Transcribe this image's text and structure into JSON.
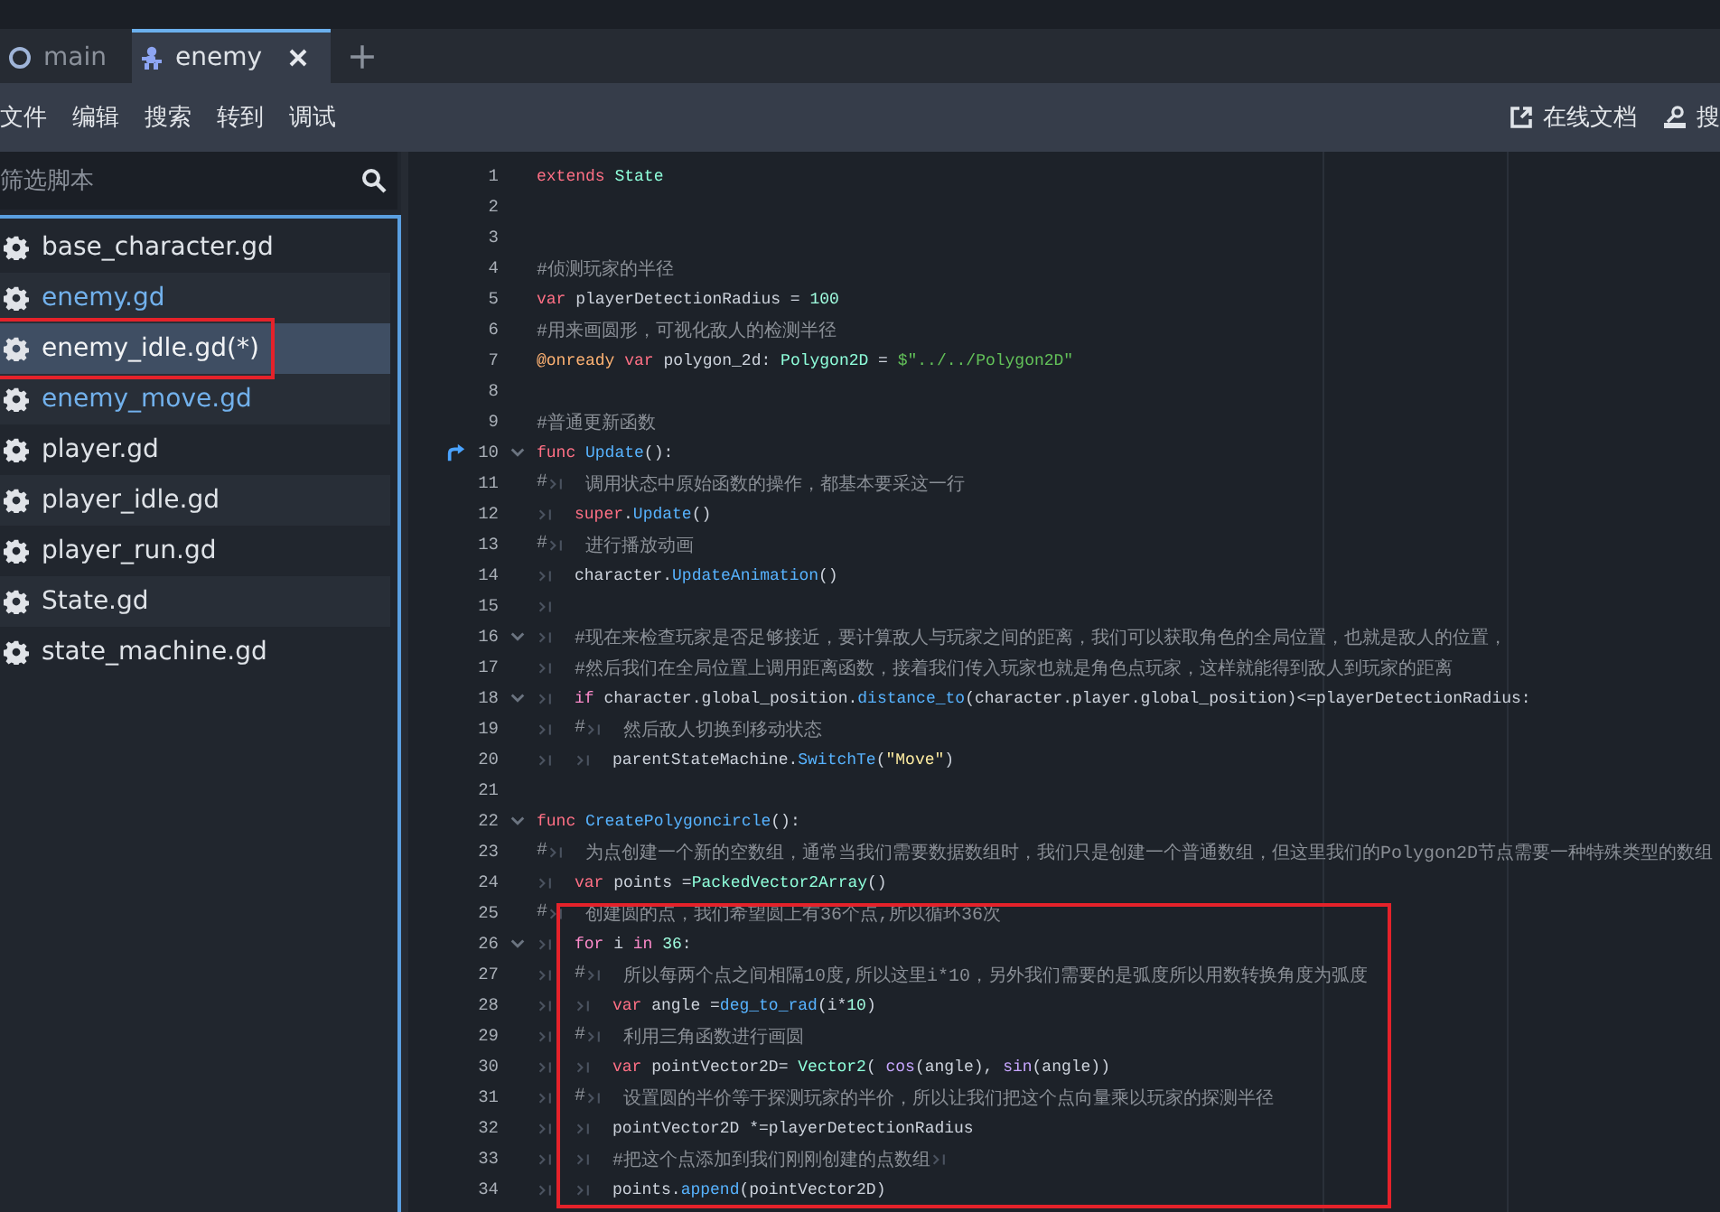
{
  "tabs": [
    {
      "label": "main",
      "kind": "scene",
      "selected": false
    },
    {
      "label": "enemy",
      "kind": "character",
      "selected": true
    }
  ],
  "menu": [
    "文件",
    "编辑",
    "搜索",
    "转到",
    "调试"
  ],
  "help_links": [
    {
      "label": "在线文档",
      "kind": "external"
    },
    {
      "label": "搜",
      "kind": "doc"
    }
  ],
  "filter": {
    "placeholder": "筛选脚本"
  },
  "scripts": [
    {
      "name": "base_character.gd",
      "selected": false,
      "open": false,
      "circled": false
    },
    {
      "name": "enemy.gd",
      "selected": false,
      "open": true,
      "circled": false
    },
    {
      "name": "enemy_idle.gd(*)",
      "selected": true,
      "open": false,
      "circled": true
    },
    {
      "name": "enemy_move.gd",
      "selected": false,
      "open": true,
      "circled": false
    },
    {
      "name": "player.gd",
      "selected": false,
      "open": false,
      "circled": false
    },
    {
      "name": "player_idle.gd",
      "selected": false,
      "open": false,
      "circled": false
    },
    {
      "name": "player_run.gd",
      "selected": false,
      "open": false,
      "circled": false
    },
    {
      "name": "State.gd",
      "selected": false,
      "open": false,
      "circled": false
    },
    {
      "name": "state_machine.gd",
      "selected": false,
      "open": false,
      "circled": false
    }
  ],
  "code": [
    {
      "n": "1",
      "fold": false,
      "override": false,
      "boxed": false,
      "tokens": [
        {
          "kind": "kw",
          "text": "extends"
        },
        {
          "kind": "cls",
          "text": " State"
        }
      ]
    },
    {
      "n": "2",
      "fold": false,
      "override": false,
      "boxed": false
    },
    {
      "n": "3",
      "fold": false,
      "override": false,
      "boxed": false
    },
    {
      "n": "4",
      "fold": false,
      "override": false,
      "boxed": false,
      "tokens": [
        {
          "kind": "cmt",
          "text": "#侦测玩家的半径"
        }
      ]
    },
    {
      "n": "5",
      "fold": false,
      "override": false,
      "boxed": false,
      "tokens": [
        {
          "kind": "kw",
          "text": "var"
        },
        {
          "kind": "plain",
          "text": " playerDetectionRadius = "
        },
        {
          "kind": "num",
          "text": "100"
        }
      ]
    },
    {
      "n": "6",
      "fold": false,
      "override": false,
      "boxed": false,
      "tokens": [
        {
          "kind": "cmt",
          "text": "#用来画圆形，可视化敌人的检测半径"
        }
      ]
    },
    {
      "n": "7",
      "fold": false,
      "override": false,
      "boxed": false,
      "tokens": [
        {
          "kind": "annot",
          "text": "@onready"
        },
        {
          "kind": "kw",
          "text": " var"
        },
        {
          "kind": "plain",
          "text": " polygon_2d: "
        },
        {
          "kind": "cls",
          "text": "Polygon2D"
        },
        {
          "kind": "plain",
          "text": " = "
        },
        {
          "kind": "path",
          "text": "$\"../../Polygon2D\""
        }
      ]
    },
    {
      "n": "8",
      "fold": false,
      "override": false,
      "boxed": false
    },
    {
      "n": "9",
      "fold": false,
      "override": false,
      "boxed": false,
      "tokens": [
        {
          "kind": "cmt",
          "text": "#普通更新函数"
        }
      ]
    },
    {
      "n": "10",
      "fold": true,
      "override": true,
      "boxed": false,
      "tokens": [
        {
          "kind": "kw",
          "text": "func"
        },
        {
          "kind": "fn",
          "text": " Update"
        },
        {
          "kind": "plain",
          "text": "():"
        }
      ]
    },
    {
      "n": "11",
      "fold": false,
      "override": false,
      "boxed": false,
      "tokens": [
        {
          "kind": "cmt",
          "text": "#"
        },
        {
          "kind": "tab"
        },
        {
          "kind": "cmt",
          "text": "调用状态中原始函数的操作，都基本要采这一行"
        }
      ]
    },
    {
      "n": "12",
      "fold": false,
      "override": false,
      "boxed": false,
      "tokens": [
        {
          "kind": "tab"
        },
        {
          "kind": "kw",
          "text": "super"
        },
        {
          "kind": "plain",
          "text": "."
        },
        {
          "kind": "fn",
          "text": "Update"
        },
        {
          "kind": "plain",
          "text": "()"
        }
      ]
    },
    {
      "n": "13",
      "fold": false,
      "override": false,
      "boxed": false,
      "tokens": [
        {
          "kind": "cmt",
          "text": "#"
        },
        {
          "kind": "tab"
        },
        {
          "kind": "cmt",
          "text": "进行播放动画"
        }
      ]
    },
    {
      "n": "14",
      "fold": false,
      "override": false,
      "boxed": false,
      "tokens": [
        {
          "kind": "tab"
        },
        {
          "kind": "plain",
          "text": "character."
        },
        {
          "kind": "fn",
          "text": "UpdateAnimation"
        },
        {
          "kind": "plain",
          "text": "()"
        }
      ]
    },
    {
      "n": "15",
      "fold": false,
      "override": false,
      "boxed": false,
      "tokens": [
        {
          "kind": "tab"
        }
      ]
    },
    {
      "n": "16",
      "fold": true,
      "override": false,
      "boxed": false,
      "tokens": [
        {
          "kind": "tab"
        },
        {
          "kind": "cmt",
          "text": "#现在来检查玩家是否足够接近，要计算敌人与玩家之间的距离，我们可以获取角色的全局位置，也就是敌人的位置，"
        }
      ]
    },
    {
      "n": "17",
      "fold": false,
      "override": false,
      "boxed": false,
      "tokens": [
        {
          "kind": "tab"
        },
        {
          "kind": "cmt",
          "text": "#然后我们在全局位置上调用距离函数，接着我们传入玩家也就是角色点玩家，这样就能得到敌人到玩家的距离"
        }
      ]
    },
    {
      "n": "18",
      "fold": true,
      "override": false,
      "boxed": false,
      "tokens": [
        {
          "kind": "tab"
        },
        {
          "kind": "flow",
          "text": "if"
        },
        {
          "kind": "plain",
          "text": " character.global_position."
        },
        {
          "kind": "fn",
          "text": "distance_to"
        },
        {
          "kind": "plain",
          "text": "(character.player.global_position)<=playerDetectionRadius:"
        }
      ]
    },
    {
      "n": "19",
      "fold": false,
      "override": false,
      "boxed": false,
      "tokens": [
        {
          "kind": "tab"
        },
        {
          "kind": "cmt",
          "text": "#"
        },
        {
          "kind": "tab"
        },
        {
          "kind": "cmt",
          "text": "然后敌人切换到移动状态"
        }
      ]
    },
    {
      "n": "20",
      "fold": false,
      "override": false,
      "boxed": false,
      "tokens": [
        {
          "kind": "tab"
        },
        {
          "kind": "tab"
        },
        {
          "kind": "plain",
          "text": "parentStateMachine."
        },
        {
          "kind": "fn",
          "text": "SwitchTe"
        },
        {
          "kind": "plain",
          "text": "("
        },
        {
          "kind": "str",
          "text": "\"Move\""
        },
        {
          "kind": "plain",
          "text": ")"
        }
      ]
    },
    {
      "n": "21",
      "fold": false,
      "override": false,
      "boxed": false
    },
    {
      "n": "22",
      "fold": true,
      "override": false,
      "boxed": false,
      "tokens": [
        {
          "kind": "kw",
          "text": "func"
        },
        {
          "kind": "fn",
          "text": " CreatePolygoncircle"
        },
        {
          "kind": "plain",
          "text": "():"
        }
      ]
    },
    {
      "n": "23",
      "fold": false,
      "override": false,
      "boxed": false,
      "tokens": [
        {
          "kind": "cmt",
          "text": "#"
        },
        {
          "kind": "tab"
        },
        {
          "kind": "cmt",
          "text": "为点创建一个新的空数组，通常当我们需要数据数组时，我们只是创建一个普通数组，但这里我们的Polygon2D节点需要一种特殊类型的数组"
        }
      ]
    },
    {
      "n": "24",
      "fold": false,
      "override": false,
      "boxed": false,
      "tokens": [
        {
          "kind": "tab"
        },
        {
          "kind": "kw",
          "text": "var"
        },
        {
          "kind": "plain",
          "text": " points ="
        },
        {
          "kind": "cls",
          "text": "PackedVector2Array"
        },
        {
          "kind": "plain",
          "text": "()"
        }
      ]
    },
    {
      "n": "25",
      "fold": false,
      "override": false,
      "boxed": true,
      "tokens": [
        {
          "kind": "cmt",
          "text": "#"
        },
        {
          "kind": "tab"
        },
        {
          "kind": "cmt",
          "text": "创建圆的点，我们希望圆上有36个点,所以循环36次"
        }
      ]
    },
    {
      "n": "26",
      "fold": true,
      "override": false,
      "boxed": true,
      "tokens": [
        {
          "kind": "tab"
        },
        {
          "kind": "flow",
          "text": "for"
        },
        {
          "kind": "plain",
          "text": " i "
        },
        {
          "kind": "flow",
          "text": "in"
        },
        {
          "kind": "num",
          "text": " 36"
        },
        {
          "kind": "plain",
          "text": ":"
        }
      ]
    },
    {
      "n": "27",
      "fold": false,
      "override": false,
      "boxed": true,
      "tokens": [
        {
          "kind": "tab"
        },
        {
          "kind": "cmt",
          "text": "#"
        },
        {
          "kind": "tab"
        },
        {
          "kind": "cmt",
          "text": "所以每两个点之间相隔10度,所以这里i*10，另外我们需要的是弧度所以用数转换角度为弧度"
        }
      ]
    },
    {
      "n": "28",
      "fold": false,
      "override": false,
      "boxed": true,
      "tokens": [
        {
          "kind": "tab"
        },
        {
          "kind": "tab"
        },
        {
          "kind": "kw",
          "text": "var"
        },
        {
          "kind": "plain",
          "text": " angle ="
        },
        {
          "kind": "fn",
          "text": "deg_to_rad"
        },
        {
          "kind": "plain",
          "text": "(i*"
        },
        {
          "kind": "num",
          "text": "10"
        },
        {
          "kind": "plain",
          "text": ")"
        }
      ]
    },
    {
      "n": "29",
      "fold": false,
      "override": false,
      "boxed": true,
      "tokens": [
        {
          "kind": "tab"
        },
        {
          "kind": "cmt",
          "text": "#"
        },
        {
          "kind": "tab"
        },
        {
          "kind": "cmt",
          "text": "利用三角函数进行画圆"
        }
      ]
    },
    {
      "n": "30",
      "fold": false,
      "override": false,
      "boxed": true,
      "tokens": [
        {
          "kind": "tab"
        },
        {
          "kind": "tab"
        },
        {
          "kind": "kw",
          "text": "var"
        },
        {
          "kind": "plain",
          "text": " pointVector2D= "
        },
        {
          "kind": "cls",
          "text": "Vector2"
        },
        {
          "kind": "plain",
          "text": "( "
        },
        {
          "kind": "fn2",
          "text": "cos"
        },
        {
          "kind": "plain",
          "text": "(angle), "
        },
        {
          "kind": "fn2",
          "text": "sin"
        },
        {
          "kind": "plain",
          "text": "(angle))"
        }
      ]
    },
    {
      "n": "31",
      "fold": false,
      "override": false,
      "boxed": true,
      "tokens": [
        {
          "kind": "tab"
        },
        {
          "kind": "cmt",
          "text": "#"
        },
        {
          "kind": "tab"
        },
        {
          "kind": "cmt",
          "text": "设置圆的半价等于探测玩家的半价，所以让我们把这个点向量乘以玩家的探测半径"
        }
      ]
    },
    {
      "n": "32",
      "fold": false,
      "override": false,
      "boxed": true,
      "tokens": [
        {
          "kind": "tab"
        },
        {
          "kind": "tab"
        },
        {
          "kind": "plain",
          "text": "pointVector2D *=playerDetectionRadius"
        }
      ]
    },
    {
      "n": "33",
      "fold": false,
      "override": false,
      "boxed": true,
      "tokens": [
        {
          "kind": "tab"
        },
        {
          "kind": "tab"
        },
        {
          "kind": "cmt",
          "text": "#把这个点添加到我们刚刚创建的点数组"
        },
        {
          "kind": "tab"
        }
      ]
    },
    {
      "n": "34",
      "fold": false,
      "override": false,
      "boxed": true,
      "tokens": [
        {
          "kind": "tab"
        },
        {
          "kind": "tab"
        },
        {
          "kind": "plain",
          "text": "points."
        },
        {
          "kind": "fn",
          "text": "append"
        },
        {
          "kind": "plain",
          "text": "(pointVector2D)"
        }
      ]
    }
  ]
}
